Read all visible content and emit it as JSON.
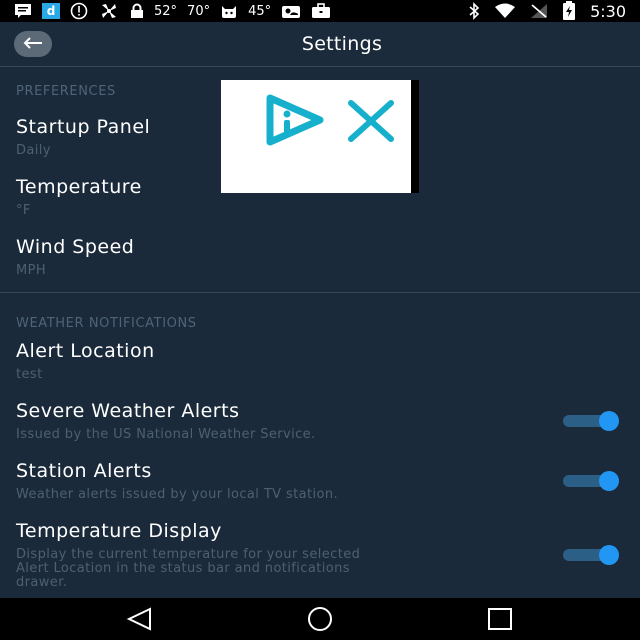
{
  "status_bar": {
    "weather1": "52°",
    "weather2": "70°",
    "weather3": "45°",
    "time": "5:30",
    "d_badge": "d"
  },
  "app_bar": {
    "title": "Settings"
  },
  "preferences": {
    "header": "PREFERENCES",
    "items": [
      {
        "title": "Startup Panel",
        "value": "Daily"
      },
      {
        "title": "Temperature",
        "value": "°F"
      },
      {
        "title": "Wind Speed",
        "value": "MPH"
      }
    ]
  },
  "notifications": {
    "header": "WEATHER NOTIFICATIONS",
    "alert_location": {
      "title": "Alert Location",
      "value": "test"
    },
    "severe": {
      "title": "Severe Weather Alerts",
      "subtitle": "Issued by the US National Weather Service.",
      "enabled": true
    },
    "station": {
      "title": "Station Alerts",
      "subtitle": "Weather alerts issued by your local TV station.",
      "enabled": true
    },
    "temp_display": {
      "title": "Temperature Display",
      "subtitle_line1": "Display the current temperature for your selected",
      "subtitle_line2": "Alert Location in the status bar and notifications",
      "subtitle_line3": "drawer.",
      "enabled": true
    }
  },
  "colors": {
    "accent": "#2196f3",
    "background": "#1a2a3a",
    "ad_logo": "#17b0cc"
  },
  "icons": [
    "message-icon",
    "d-app-icon",
    "alert-circle-icon",
    "fan-icon",
    "lock-icon",
    "cat-icon",
    "sun-cloud-icon",
    "briefcase-icon",
    "bluetooth-icon",
    "wifi-icon",
    "no-signal-icon",
    "battery-icon",
    "back-arrow-icon",
    "adchoices-icon",
    "close-icon",
    "nav-back-icon",
    "nav-home-icon",
    "nav-recents-icon"
  ]
}
